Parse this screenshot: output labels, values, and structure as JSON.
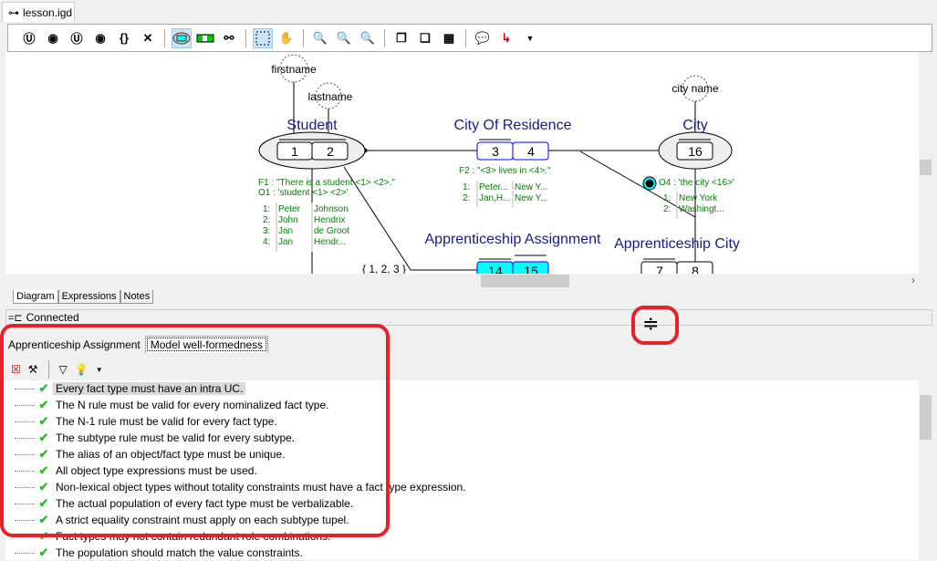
{
  "document_tab": {
    "label": "lesson.igd",
    "icon": "key-icon"
  },
  "toolbar": {
    "buttons": [
      "uniqueness-constraint",
      "preferred-identifier",
      "external-uniqueness",
      "external-identifier",
      "value-constraint",
      "exclusion-constraint",
      "object-type",
      "fact-type",
      "subtype-link",
      "select",
      "pan",
      "zoom-in",
      "zoom-fit",
      "zoom-out",
      "bring-front",
      "send-back",
      "group",
      "comment",
      "connector"
    ],
    "active": [
      "object-type",
      "select"
    ]
  },
  "diagram": {
    "objects": [
      {
        "name": "Student",
        "roles": [
          "1",
          "2"
        ]
      },
      {
        "name": "City",
        "roles": [
          "16"
        ]
      }
    ],
    "facts": [
      {
        "name": "City Of Residence",
        "roles": [
          "3",
          "4"
        ]
      },
      {
        "name": "Apprenticeship Assignment",
        "roles": [
          "14",
          "15"
        ]
      },
      {
        "name": "Apprenticeship City",
        "roles": [
          "7",
          "8"
        ]
      }
    ],
    "value_types": [
      "firstname",
      "lastname",
      "city name"
    ],
    "f1": "F1 : \"There is a student <1> <2>.\"",
    "o1": "O1 : 'student <1> <2>'",
    "student_pop": [
      [
        "1:",
        "Peter",
        "Johnson"
      ],
      [
        "2:",
        "John",
        "Hendrix"
      ],
      [
        "3:",
        "Jan",
        "de Groot"
      ],
      [
        "4:",
        "Jan",
        "Hendr..."
      ]
    ],
    "f2": "F2 : \"<3> lives in <4>.\"",
    "res_pop": [
      [
        "1:",
        "Peter...",
        "New Y..."
      ],
      [
        "2:",
        "Jan,H...",
        "New Y..."
      ]
    ],
    "o4": "O4 : 'the city <16>'",
    "city_pop": [
      [
        "1:",
        "New York"
      ],
      [
        "2:",
        "Washingt..."
      ]
    ],
    "value_constraint": "{ 1, 2, 3 }"
  },
  "bottom_tabs": [
    "Diagram",
    "Expressions",
    "Notes"
  ],
  "status": {
    "text": "Connected",
    "icon": "plug-icon"
  },
  "panel": {
    "tabs": [
      "Apprenticeship Assignment",
      "Model well-formedness"
    ],
    "active_tab": "Model well-formedness",
    "rules": [
      "Every fact type must have an intra UC.",
      "The N rule must be valid for every nominalized fact type.",
      "The N-1 rule must be valid for every fact type.",
      "The subtype rule must be valid for every subtype.",
      "The alias of an object/fact type must be unique.",
      "All object type expressions must be used.",
      "Non-lexical object types without totality constraints must have a fact type expression.",
      "The actual population of every fact type must be verbalizable.",
      "A strict equality constraint must apply on each subtype tupel.",
      "Fact types may not contain redundant role combinations.",
      "The population should match the value constraints."
    ]
  },
  "colors": {
    "highlight": "#e8202a",
    "pass": "#22c022",
    "title": "#1a1a8c",
    "population": "#008000",
    "selected_role": "#00ffff"
  }
}
